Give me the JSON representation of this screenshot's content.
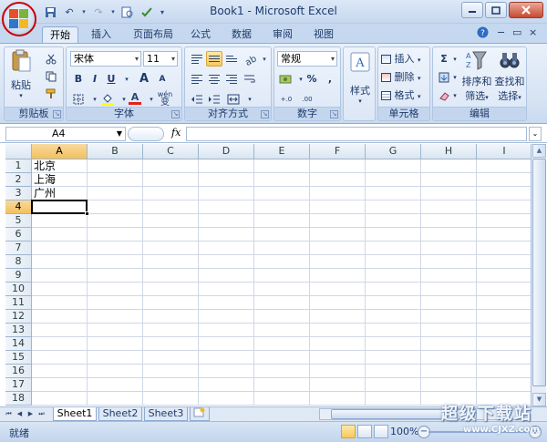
{
  "window": {
    "title": "Book1 - Microsoft Excel"
  },
  "ribbon": {
    "tabs": [
      {
        "label": "开始",
        "active": true
      },
      {
        "label": "插入"
      },
      {
        "label": "页面布局"
      },
      {
        "label": "公式"
      },
      {
        "label": "数据"
      },
      {
        "label": "审阅"
      },
      {
        "label": "视图"
      }
    ],
    "clipboard": {
      "paste": "粘贴",
      "label": "剪贴板"
    },
    "font": {
      "name": "宋体",
      "size": "11",
      "bold": "B",
      "italic": "I",
      "underline": "U",
      "grow": "A",
      "shrink": "A",
      "color": "A",
      "wen": "wén",
      "wen2": "变",
      "label": "字体"
    },
    "alignment": {
      "label": "对齐方式"
    },
    "number": {
      "format": "常规",
      "percent": "%",
      "comma": ",",
      "currency": "$",
      "inc": "+.0",
      "dec": ".00",
      "label": "数字"
    },
    "styles": {
      "label": "样式"
    },
    "cells": {
      "insert": "插入",
      "delete": "删除",
      "format": "格式",
      "label": "单元格"
    },
    "editing": {
      "sum": "Σ",
      "sort": "排序和",
      "filter": "筛选",
      "find": "查找和",
      "select": "选择",
      "label": "编辑"
    }
  },
  "formula_bar": {
    "name_box": "A4",
    "fx": "fx",
    "value": ""
  },
  "grid": {
    "columns": [
      "A",
      "B",
      "C",
      "D",
      "E",
      "F",
      "G",
      "H",
      "I"
    ],
    "rows": [
      "1",
      "2",
      "3",
      "4",
      "5",
      "6",
      "7",
      "8",
      "9",
      "10",
      "11",
      "12",
      "13",
      "14",
      "15",
      "16",
      "17",
      "18"
    ],
    "cells": {
      "A1": "北京",
      "A2": "上海",
      "A3": "广州"
    },
    "active_cell": "A4"
  },
  "sheets": [
    "Sheet1",
    "Sheet2",
    "Sheet3"
  ],
  "active_sheet": "Sheet1",
  "status": {
    "ready": "就绪",
    "zoom": "100%"
  },
  "watermark": {
    "big": "超级下载站",
    "small": "www.CJXZ.com"
  },
  "colors": {
    "ribbon_bg": "#dce7f6",
    "active_highlight": "#f8c85b",
    "close_button": "#c74a2f"
  }
}
